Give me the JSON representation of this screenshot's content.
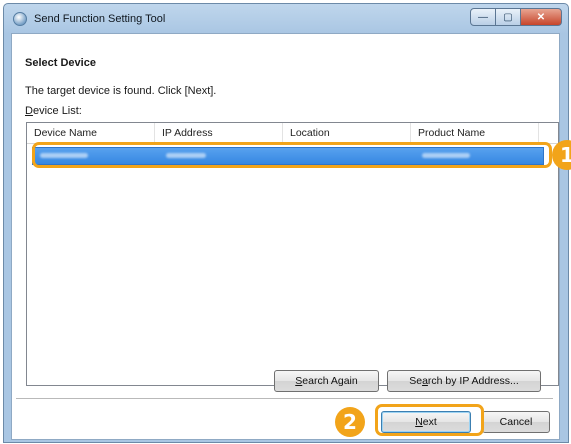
{
  "window": {
    "title": "Send Function Setting Tool",
    "controls": {
      "minimize": "—",
      "maximize": "▢",
      "close": "✕"
    }
  },
  "page": {
    "heading": "Select Device",
    "instruction": "The target device is found. Click [Next].",
    "list_label_mnemonic": "D",
    "list_label_rest": "evice List:"
  },
  "device_list": {
    "columns": [
      "Device Name",
      "IP Address",
      "Location",
      "Product Name"
    ],
    "selected_row_note": "obscured"
  },
  "buttons": {
    "search_again_mnemonic": "S",
    "search_again_rest": "earch Again",
    "search_ip_pre": "Se",
    "search_ip_mnemonic": "a",
    "search_ip_rest": "rch by IP Address...",
    "next_mnemonic": "N",
    "next_rest": "ext",
    "cancel": "Cancel"
  },
  "callouts": {
    "one": "1",
    "two": "2"
  },
  "colors": {
    "highlight": "#f2a41a",
    "selection": "#3486e2",
    "title_bar": "#a9c6e3"
  }
}
